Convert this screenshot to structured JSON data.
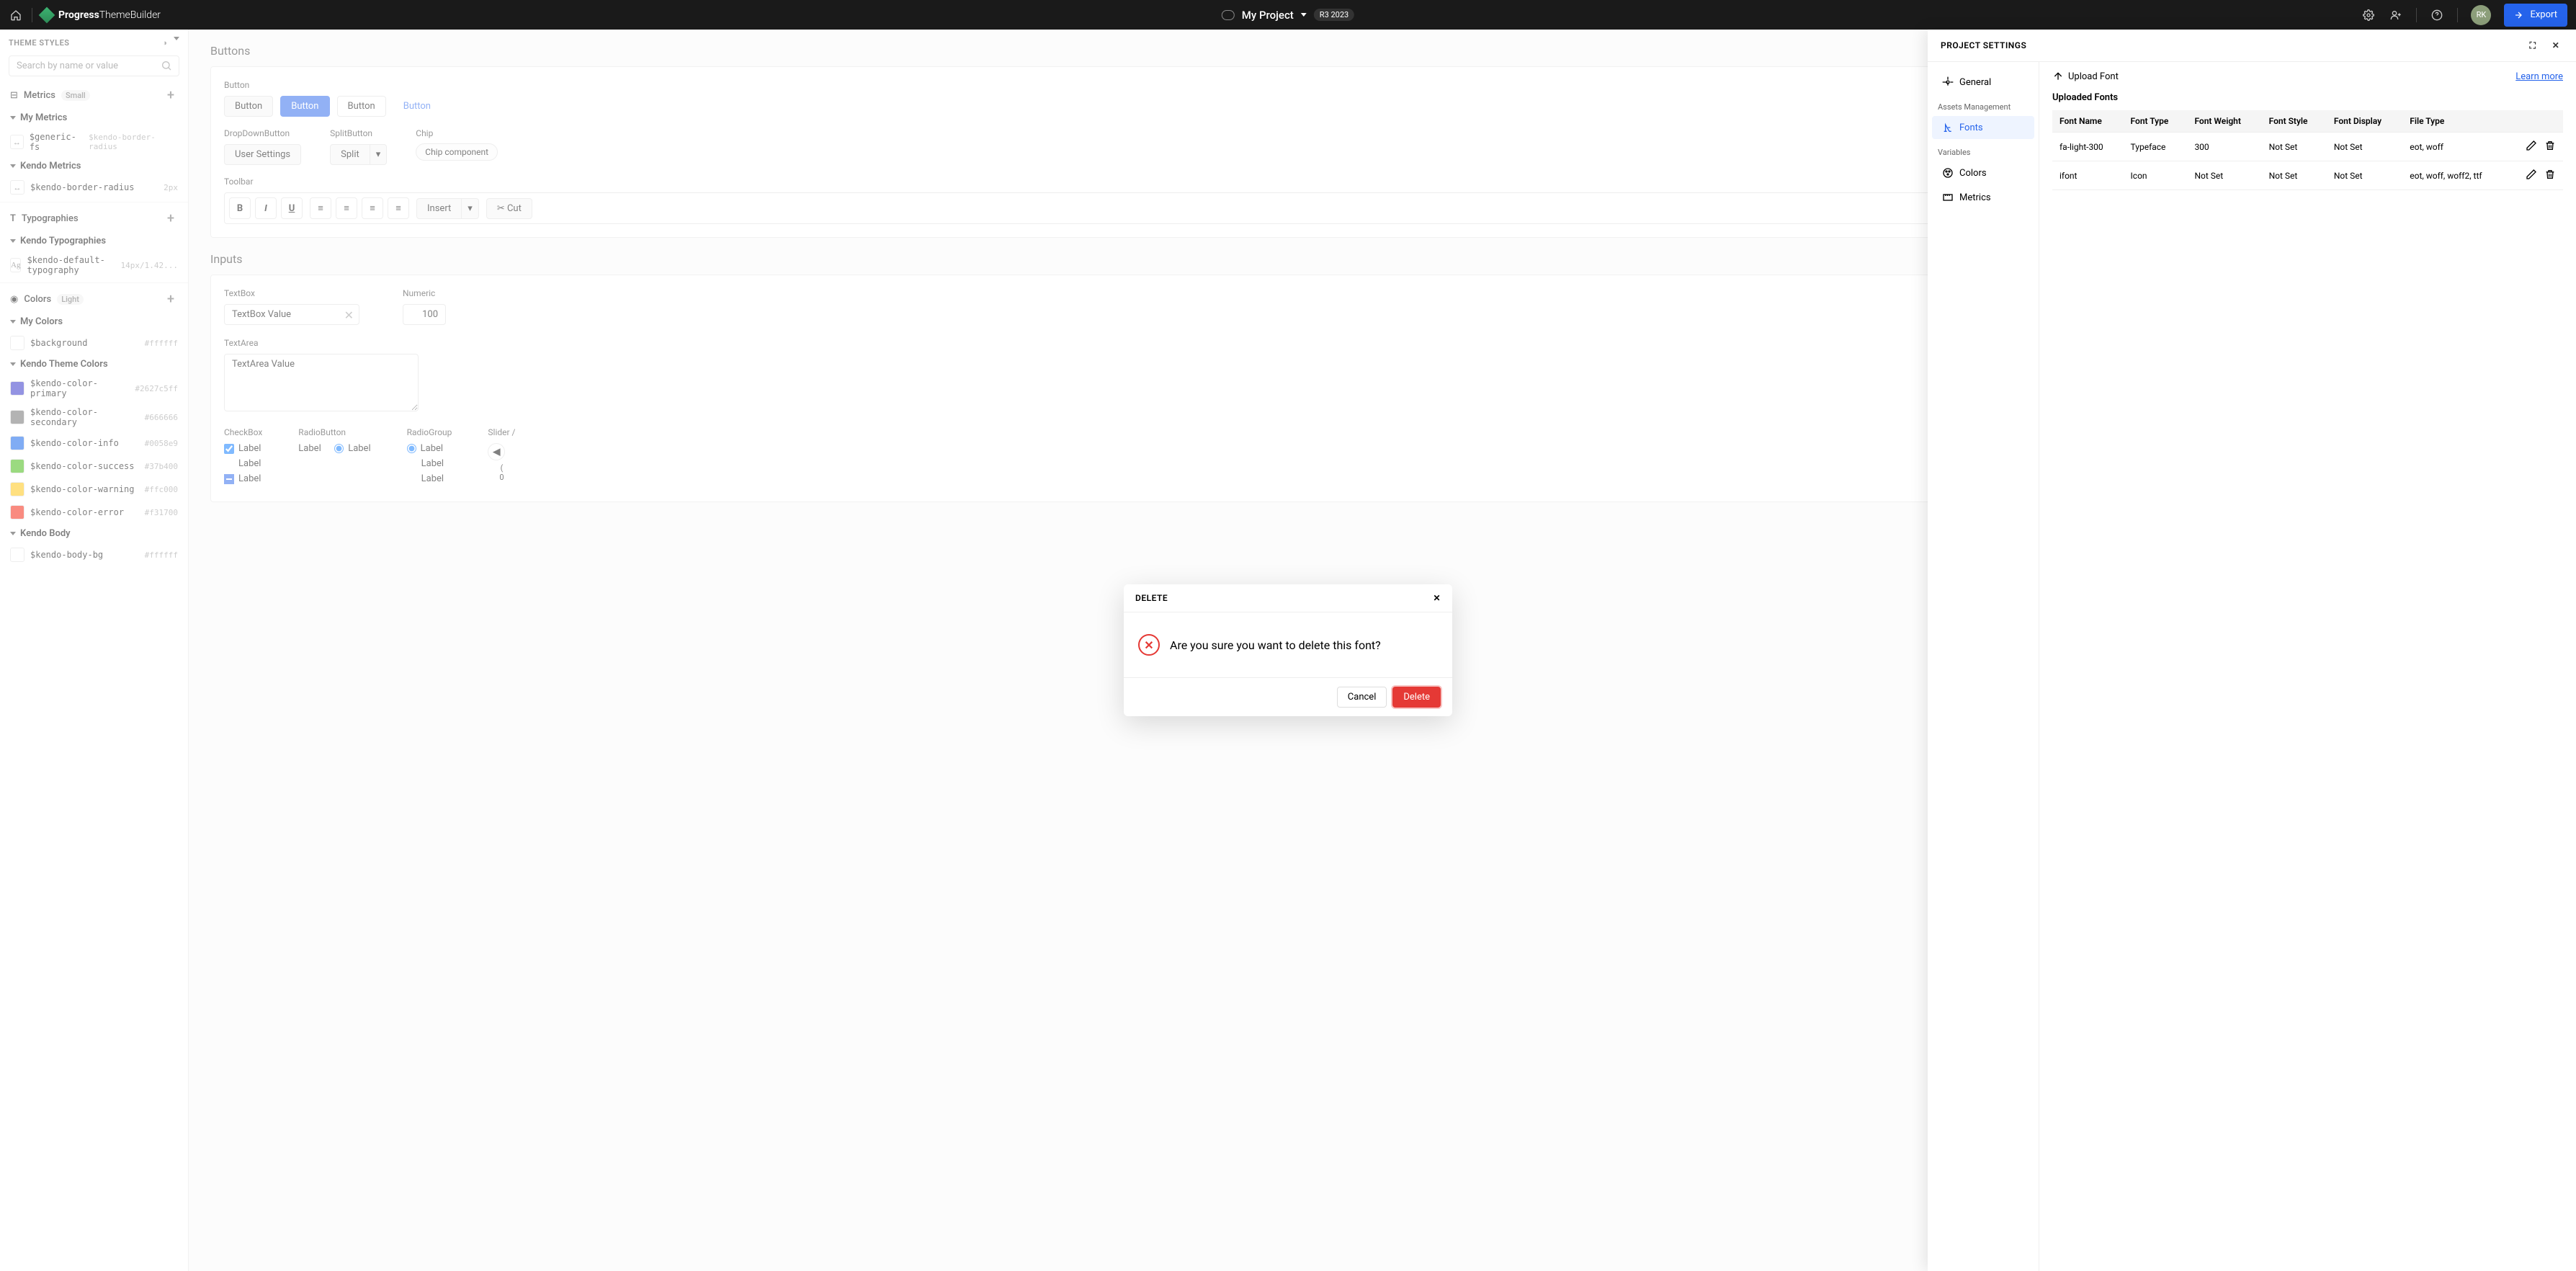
{
  "topnav": {
    "brand_bold": "Progress",
    "brand_light": "ThemeBuilder",
    "project": "My Project",
    "version": "R3 2023",
    "avatar": "RK",
    "export": "Export"
  },
  "sidebar": {
    "title": "THEME STYLES",
    "search_placeholder": "Search by name or value",
    "metrics_section": "Metrics",
    "metrics_tag": "Small",
    "my_metrics": "My Metrics",
    "generic_fs": "$generic-fs",
    "generic_fs_val": "$kendo-border-radius",
    "kendo_metrics": "Kendo Metrics",
    "border_radius": "$kendo-border-radius",
    "border_radius_val": "2px",
    "typographies": "Typographies",
    "kendo_typographies": "Kendo Typographies",
    "default_typography": "$kendo-default-typography",
    "default_typography_val": "14px/1.42...",
    "typography_icon": "Ag",
    "colors_section": "Colors",
    "colors_tag": "Light",
    "my_colors": "My Colors",
    "background": "$background",
    "background_val": "#ffffff",
    "kendo_theme_colors": "Kendo Theme Colors",
    "colors": [
      {
        "name": "$kendo-color-primary",
        "value": "#2627c5ff",
        "swatch": "#2627c5"
      },
      {
        "name": "$kendo-color-secondary",
        "value": "#666666",
        "swatch": "#666666"
      },
      {
        "name": "$kendo-color-info",
        "value": "#0058e9",
        "swatch": "#0058e9"
      },
      {
        "name": "$kendo-color-success",
        "value": "#37b400",
        "swatch": "#37b400"
      },
      {
        "name": "$kendo-color-warning",
        "value": "#ffc000",
        "swatch": "#ffc000"
      },
      {
        "name": "$kendo-color-error",
        "value": "#f31700",
        "swatch": "#f31700"
      }
    ],
    "kendo_body": "Kendo Body",
    "body_bg": "$kendo-body-bg",
    "body_bg_val": "#ffffff"
  },
  "canvas": {
    "buttons_title": "Buttons",
    "button_label": "Button",
    "btn_text": "Button",
    "dropdown_button": "DropDownButton",
    "split_button": "SplitButton",
    "chip_label": "Chip",
    "user_settings": "User Settings",
    "split": "Split",
    "chip_comp": "Chip component",
    "toolbar": "Toolbar",
    "insert": "Insert",
    "cut": "Cut",
    "inputs_title": "Inputs",
    "textbox": "TextBox",
    "textbox_value": "TextBox Value",
    "numeric": "Numeric",
    "numeric_value": "100",
    "textarea": "TextArea",
    "textarea_value": "TextArea Value",
    "checkbox": "CheckBox",
    "radiobutton": "RadioButton",
    "radiogroup": "RadioGroup",
    "slider": "Slider /",
    "label": "Label",
    "zero_prefix": "(",
    "slider_val": "0"
  },
  "panel": {
    "title": "PROJECT SETTINGS",
    "general": "General",
    "assets_mgmt": "Assets Management",
    "fonts": "Fonts",
    "variables": "Variables",
    "colors": "Colors",
    "metrics": "Metrics",
    "upload_font": "Upload Font",
    "learn_more": "Learn more",
    "uploaded_fonts": "Uploaded Fonts",
    "headers": {
      "name": "Font Name",
      "type": "Font Type",
      "weight": "Font Weight",
      "style": "Font Style",
      "display": "Font Display",
      "file_type": "File Type"
    },
    "rows": [
      {
        "name": "fa-light-300",
        "type": "Typeface",
        "weight": "300",
        "style": "Not Set",
        "display": "Not Set",
        "file_type": "eot, woff"
      },
      {
        "name": "ifont",
        "type": "Icon",
        "weight": "Not Set",
        "style": "Not Set",
        "display": "Not Set",
        "file_type": "eot, woff, woff2, ttf"
      }
    ]
  },
  "modal": {
    "title": "DELETE",
    "message": "Are you sure you want to delete this font?",
    "cancel": "Cancel",
    "delete": "Delete"
  }
}
